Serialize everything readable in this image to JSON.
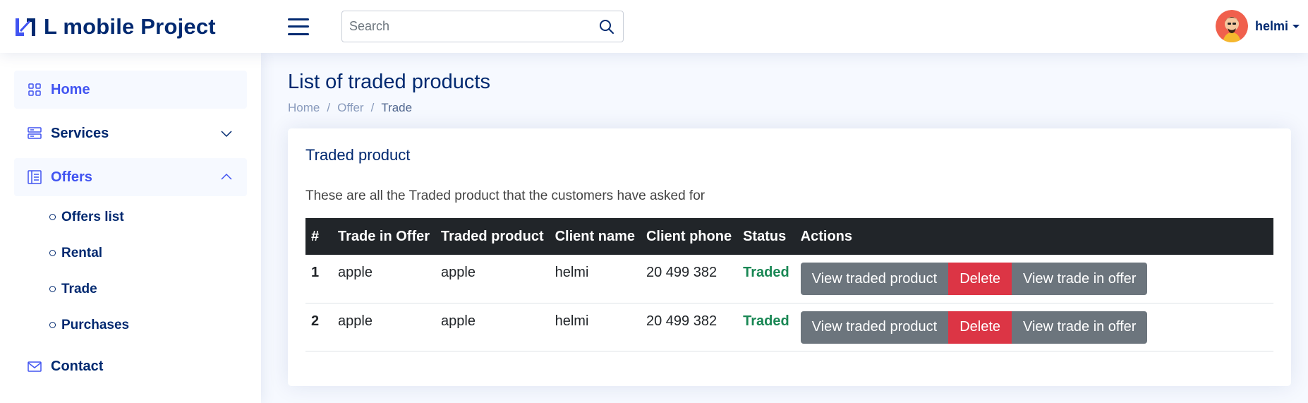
{
  "header": {
    "logo_text": "L mobile Project",
    "search_placeholder": "Search",
    "user_name": "helmi"
  },
  "sidebar": {
    "items": [
      {
        "label": "Home",
        "icon": "grid-icon"
      },
      {
        "label": "Services",
        "icon": "server-icon"
      },
      {
        "label": "Offers",
        "icon": "layout-text-icon"
      },
      {
        "label": "Contact",
        "icon": "envelope-icon"
      }
    ],
    "offers_submenu": [
      "Offers list",
      "Rental",
      "Trade",
      "Purchases"
    ]
  },
  "page": {
    "title": "List of traded products",
    "breadcrumb": [
      "Home",
      "Offer",
      "Trade"
    ],
    "breadcrumb_sep": "/"
  },
  "card": {
    "title": "Traded product",
    "description": "These are all the Traded product that the customers have asked for"
  },
  "table": {
    "headers": [
      "#",
      "Trade in Offer",
      "Traded product",
      "Client name",
      "Client phone",
      "Status",
      "Actions"
    ],
    "rows": [
      {
        "index": "1",
        "trade_in_offer": "apple",
        "traded_product": "apple",
        "client_name": "helmi",
        "client_phone": "20 499 382",
        "status": "Traded"
      },
      {
        "index": "2",
        "trade_in_offer": "apple",
        "traded_product": "apple",
        "client_name": "helmi",
        "client_phone": "20 499 382",
        "status": "Traded"
      }
    ],
    "actions": {
      "view_traded": "View traded product",
      "delete": "Delete",
      "view_trade_in_offer": "View trade in offer"
    }
  },
  "colors": {
    "brand": "#012970",
    "accent": "#4154f1",
    "status_traded": "#198754",
    "danger": "#dc3545",
    "secondary": "#6c757d",
    "table_head": "#212529"
  }
}
